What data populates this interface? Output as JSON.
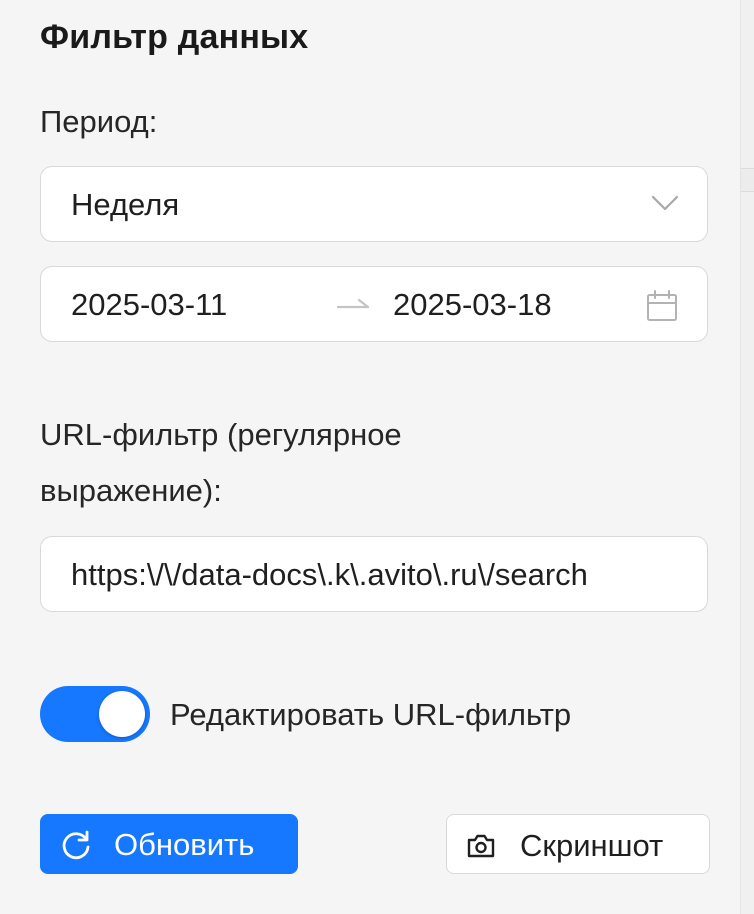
{
  "panel": {
    "title": "Фильтр данных"
  },
  "period": {
    "label": "Период:",
    "selected": "Неделя",
    "icon": "chevron-down-icon"
  },
  "date_range": {
    "start": "2025-03-11",
    "end": "2025-03-18",
    "separator_icon": "arrow-right-icon",
    "icon": "calendar-icon"
  },
  "url_filter": {
    "label_line1": "URL-фильтр (регулярное",
    "label_line2": "выражение):",
    "value": "https:\\/\\/data-docs\\.k\\.avito\\.ru\\/search"
  },
  "edit_toggle": {
    "state": "on",
    "label": "Редактировать URL-фильтр"
  },
  "buttons": {
    "refresh_label": "Обновить",
    "refresh_icon": "refresh-icon",
    "screenshot_label": "Скриншот",
    "screenshot_icon": "camera-icon"
  },
  "colors": {
    "accent": "#1677ff",
    "background": "#f5f5f5",
    "border": "#d9d9d9"
  }
}
